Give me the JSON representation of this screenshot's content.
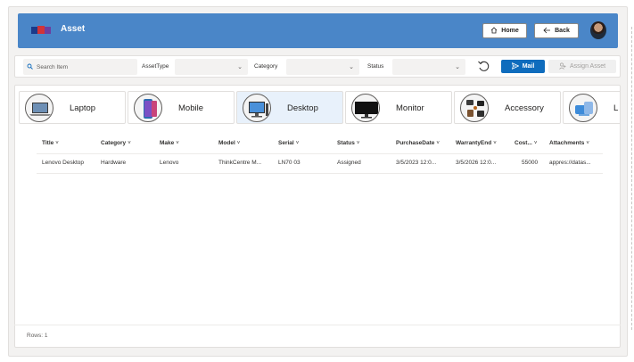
{
  "header": {
    "title": "Asset",
    "home_label": "Home",
    "back_label": "Back"
  },
  "filters": {
    "search_placeholder": "Search Item",
    "asset_type_label": "AssetType",
    "category_label": "Category",
    "status_label": "Status",
    "mail_label": "Mail",
    "assign_label": "Assign Asset"
  },
  "categories": [
    {
      "label": "Laptop"
    },
    {
      "label": "Mobile"
    },
    {
      "label": "Desktop",
      "selected": true
    },
    {
      "label": "Monitor"
    },
    {
      "label": "Accessory"
    },
    {
      "label": "L"
    }
  ],
  "table": {
    "columns": [
      "Title",
      "Category",
      "Make",
      "Model",
      "Serial",
      "Status",
      "PurchaseDate",
      "WarrantyEnd",
      "Cost...",
      "Attachments"
    ],
    "rows": [
      [
        "Lenovo Desktop",
        "Hardware",
        "Lenovo",
        "ThinkCentre M...",
        "LN70 03",
        "Assigned",
        "3/5/2023 12:0...",
        "3/5/2026 12:0...",
        "55000",
        "appres://datas..."
      ]
    ]
  },
  "footer": {
    "rows_label": "Rows: 1"
  },
  "colors": {
    "header_bg": "#4a86c8",
    "accent": "#0f6cbd",
    "selected_card": "#e8f1fb"
  }
}
